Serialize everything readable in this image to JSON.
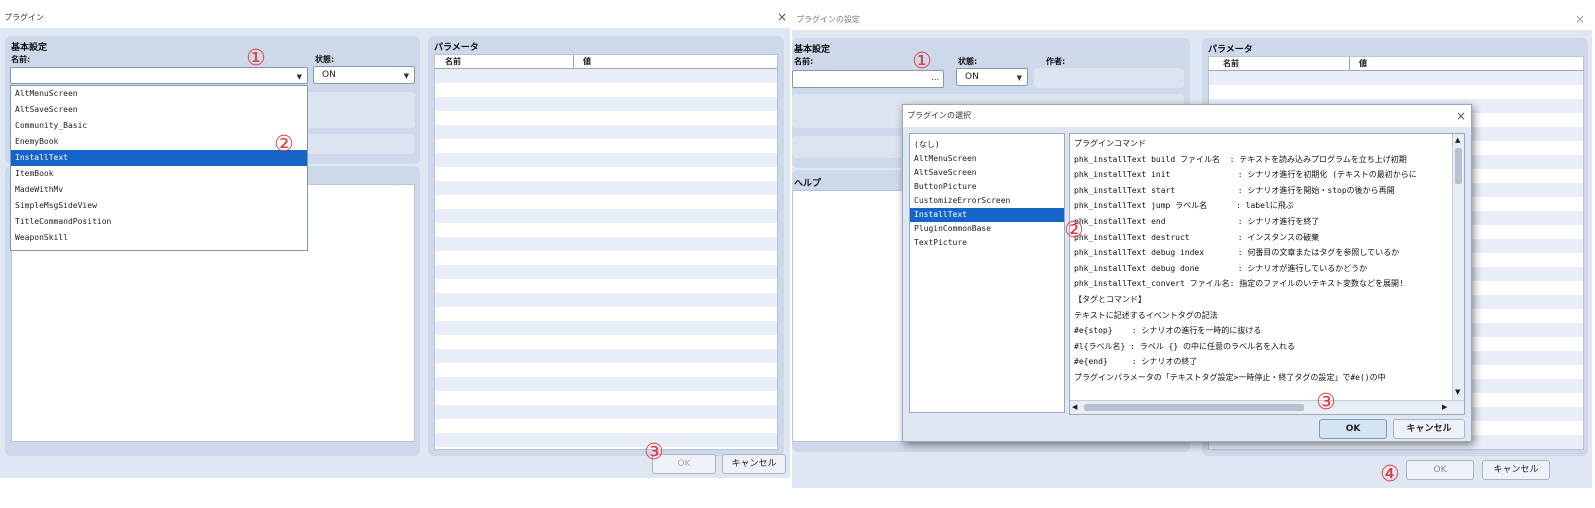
{
  "left": {
    "title": "プラグイン",
    "close_symbol": "×",
    "basic_heading": "基本設定",
    "name_label": "名前:",
    "status_label": "状態:",
    "status_value": "ON",
    "params_heading": "パラメータ",
    "col_name": "名前",
    "col_value": "値",
    "dropdown_items": [
      "AltMenuScreen",
      "AltSaveScreen",
      "Community_Basic",
      "EnemyBook",
      "InstallText",
      "ItemBook",
      "MadeWithMv",
      "SimpleMsgSideView",
      "TitleCommandPosition",
      "WeaponSkill"
    ],
    "selected_item": "InstallText",
    "ok_label": "OK",
    "cancel_label": "キャンセル",
    "markers": [
      "①",
      "②",
      "③"
    ]
  },
  "right": {
    "title": "プラグインの設定",
    "close_symbol": "×",
    "basic_heading": "基本設定",
    "name_label": "名前:",
    "ellipsis": "...",
    "status_label": "状態:",
    "status_value": "ON",
    "author_label": "作者:",
    "help_heading": "ヘルプ",
    "params_heading": "パラメータ",
    "col_name": "名前",
    "col_value": "値",
    "ok_label": "OK",
    "cancel_label": "キャンセル",
    "markers": [
      "①",
      "④"
    ]
  },
  "dialog": {
    "title": "プラグインの選択",
    "close_symbol": "×",
    "list_items": [
      "(なし)",
      "AltMenuScreen",
      "AltSaveScreen",
      "ButtonPicture",
      "CustomizeErrorScreen",
      "InstallText",
      "PluginCommonBase",
      "TextPicture"
    ],
    "selected_item": "InstallText",
    "help_lines": [
      "プラグインコマンド",
      "phk_installText build ファイル名  : テキストを読み込みプログラムを立ち上げ初期",
      "phk_installText init              : シナリオ進行を初期化 (テキストの最初からに",
      "phk_installText start             : シナリオ進行を開始・stopの後から再開",
      "phk_installText jump ラベル名      : labelに飛ぶ",
      "phk_installText end               : シナリオ進行を終了",
      "phk_installText destruct          : インスタンスの破棄",
      "phk_installText debug index       : 何番目の文章またはタグを参照しているか",
      "phk_installText debug done        : シナリオが進行しているかどうか",
      "phk_installText_convert ファイル名: 指定のファイルのいテキスト変数などを展開!",
      "",
      "【タグとコマンド】",
      "",
      "テキストに記述するイベントタグの記法",
      "#e{stop}    : シナリオの進行を一時的に抜ける",
      "#l{ラベル名} : ラベル {} の中に任意のラベル名を入れる",
      "#e{end}     : シナリオの終了",
      "プラグインパラメータの「テキストタグ設定>一時停止・終了タグの設定」で#e()の中"
    ],
    "ok_label": "OK",
    "cancel_label": "キャンセル",
    "markers": [
      "②",
      "③"
    ]
  }
}
